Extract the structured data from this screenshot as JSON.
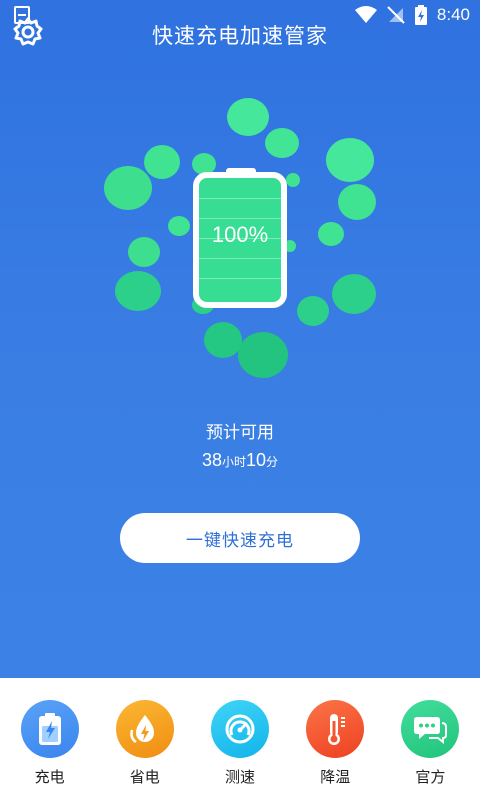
{
  "status_bar": {
    "time": "8:40"
  },
  "header": {
    "title": "快速充电加速管家",
    "settings_icon": "gear-icon"
  },
  "battery": {
    "percent_text": "100%",
    "level": 1.0
  },
  "estimate": {
    "label": "预计可用",
    "hours": "38",
    "hours_unit": "小时",
    "minutes": "10",
    "minutes_unit": "分"
  },
  "primary_button": {
    "label": "一键快速充电"
  },
  "bottom_nav": {
    "items": [
      {
        "label": "充电",
        "icon": "battery-icon",
        "color": "#3d8df2"
      },
      {
        "label": "省电",
        "icon": "power-save-icon",
        "color": "#f7a21b"
      },
      {
        "label": "测速",
        "icon": "speedometer-icon",
        "color": "#1fc2f0"
      },
      {
        "label": "降温",
        "icon": "thermometer-icon",
        "color": "#f5562f"
      },
      {
        "label": "官方",
        "icon": "chat-icon",
        "color": "#2fd08a"
      }
    ]
  },
  "colors": {
    "background": "#2f72e0",
    "bubble": "#3fe391",
    "accent_text": "#2f6fd8"
  }
}
